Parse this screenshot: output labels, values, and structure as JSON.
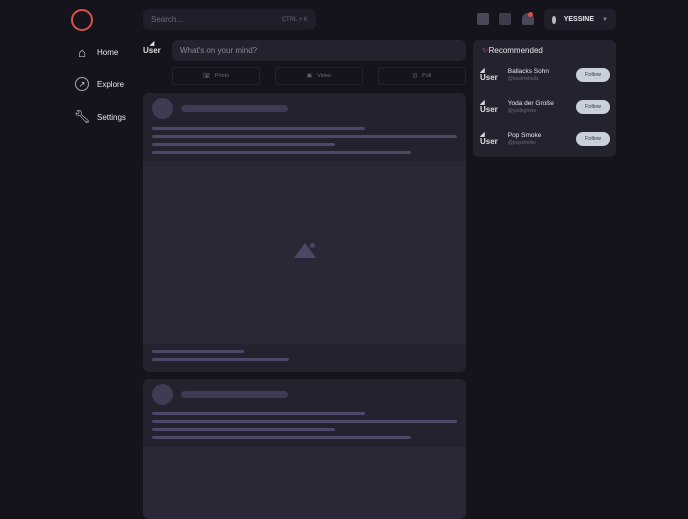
{
  "nav": {
    "items": [
      {
        "label": "Home",
        "icon": "home-icon"
      },
      {
        "label": "Explore",
        "icon": "compass-icon"
      },
      {
        "label": "Settings",
        "icon": "wrench-icon"
      }
    ]
  },
  "search": {
    "placeholder": "Search...",
    "shortcut": "CTRL + K"
  },
  "header": {
    "username": "YESSINE"
  },
  "composer": {
    "avatar": "User",
    "placeholder": "What's on your mind?",
    "buttons": [
      "Photo",
      "Video",
      "Poll"
    ]
  },
  "recommended": {
    "title": "Recommended",
    "items": [
      {
        "avatar": "User",
        "name": "Ballacks Sohn",
        "handle": "@bizarreballz",
        "action": "Follow"
      },
      {
        "avatar": "User",
        "name": "Yoda der Große",
        "handle": "@yodagross",
        "action": "Follow"
      },
      {
        "avatar": "User",
        "name": "Pop Smoke",
        "handle": "@popsmoke",
        "action": "Follow"
      }
    ]
  },
  "colors": {
    "accent": "#d8504a",
    "bg": "#15141c",
    "card": "#24222f"
  }
}
